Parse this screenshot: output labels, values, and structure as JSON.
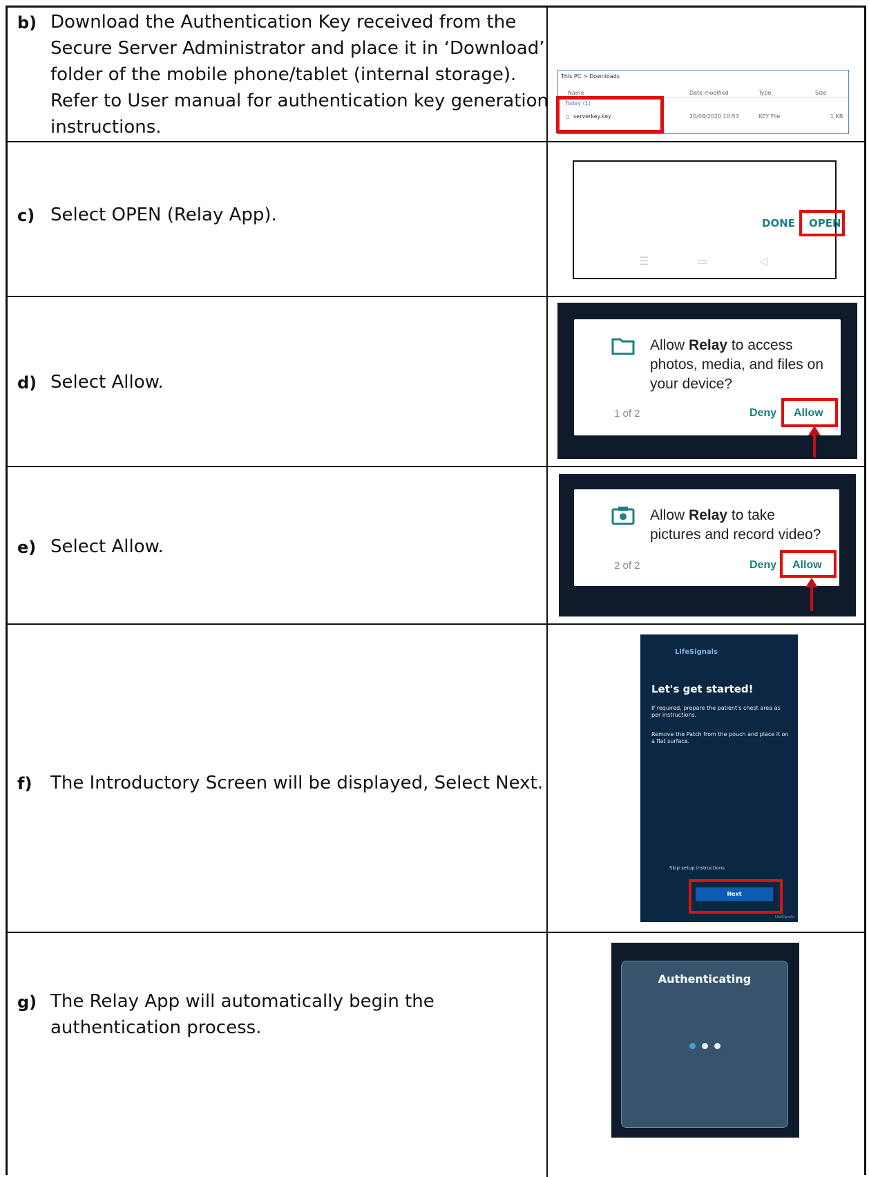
{
  "rows": [
    {
      "letter": "b)",
      "lines": [
        "Download the Authentication Key received from the",
        "Secure Server Administrator  and place it in ‘Download’",
        "folder of the mobile phone/tablet (internal storage).",
        "Refer to User manual for authentication key generation",
        "instructions."
      ]
    },
    {
      "letter": "c)",
      "lines": [
        "Select OPEN (Relay App)."
      ]
    },
    {
      "letter": "d)",
      "lines": [
        "Select Allow."
      ]
    },
    {
      "letter": "e)",
      "lines": [
        "Select Allow."
      ]
    },
    {
      "letter": "f)",
      "lines": [
        "The Introductory Screen will be displayed, Select Next."
      ]
    },
    {
      "letter": "g)",
      "lines": [
        "The Relay App will automatically begin the",
        "authentication process."
      ]
    }
  ],
  "explorer": {
    "breadcrumb": "This PC  >  Downloads",
    "col_name": "Name",
    "col_date": "Date modified",
    "col_type": "Type",
    "col_size": "Size",
    "group": "Today (1)",
    "file_name": "serverkey.key",
    "file_date": "20/08/2020 10:53",
    "file_type": "KEY File",
    "file_size": "1 KB"
  },
  "share_dialog": {
    "done": "DONE",
    "open": "OPEN"
  },
  "perm_storage": {
    "msg_pre": "Allow ",
    "app": "Relay",
    "msg_post": " to access photos, media, and files on your device?",
    "page": "1 of 2",
    "deny": "Deny",
    "allow": "Allow"
  },
  "perm_camera": {
    "msg_pre": "Allow ",
    "app": "Relay",
    "msg_post": " to take pictures and record video?",
    "page": "2 of 2",
    "deny": "Deny",
    "allow": "Allow"
  },
  "intro": {
    "brand": "LifeSignals",
    "title": "Let's get started!",
    "p1": "If required, prepare the patient's chest area as per instructions.",
    "p2": "Remove the Patch from the pouch and place it on a flat surface.",
    "skip": "Skip setup instructions",
    "next": "Next",
    "footer": "LifeSignals"
  },
  "auth": {
    "label": "Authenticating"
  },
  "colors": {
    "accent": "#1d7f7f",
    "highlight": "#e01010",
    "arrow": "#c0101a"
  }
}
